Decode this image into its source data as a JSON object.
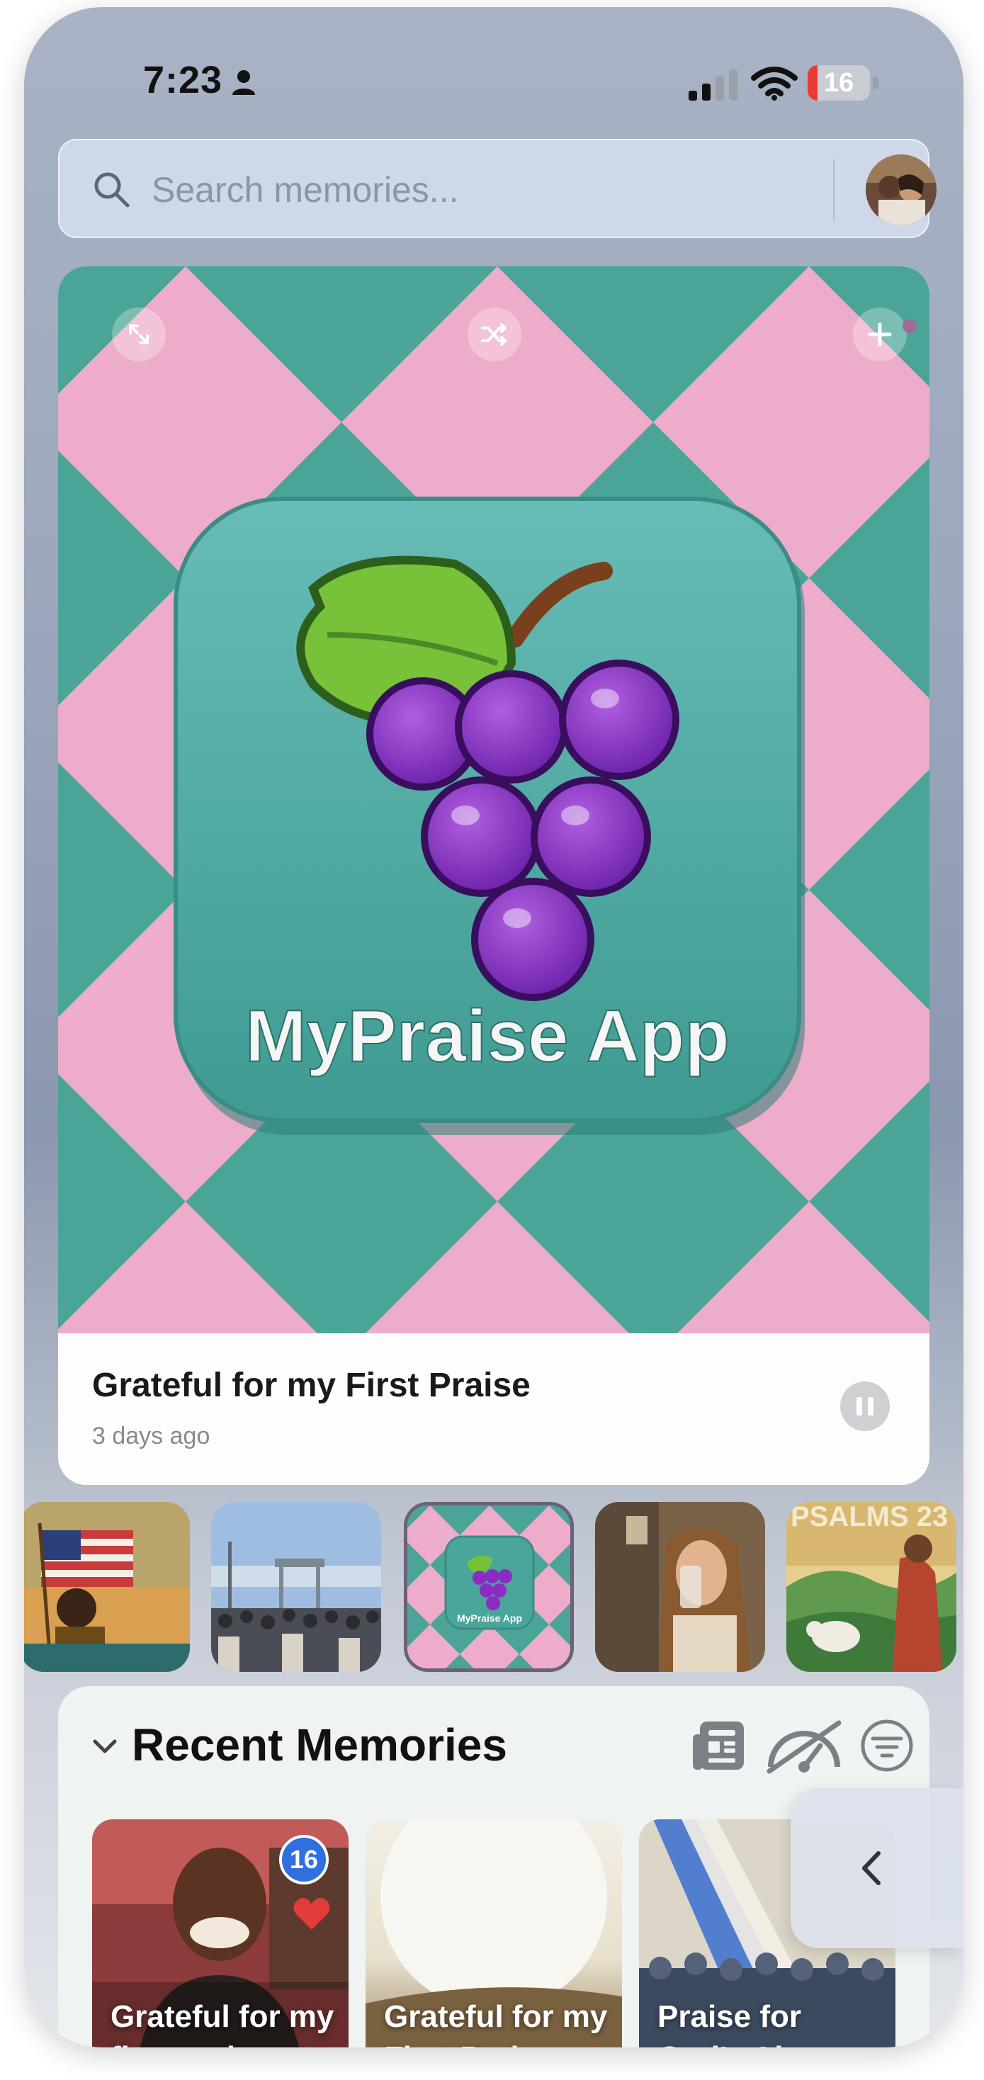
{
  "status_bar": {
    "time": "7:23",
    "battery_level": "16",
    "battery_fraction": 0.16
  },
  "search": {
    "placeholder": "Search memories..."
  },
  "hero": {
    "app_name": "MyPraise App",
    "title": "Grateful for my First Praise",
    "subtitle": "3 days ago",
    "controls": [
      "expand-icon",
      "shuffle-icon",
      "plus-icon",
      "pause-icon"
    ]
  },
  "thumbnails": [
    {
      "label": "Flag celebration"
    },
    {
      "label": "Boardwalk crowd"
    },
    {
      "label": "MyPraise App",
      "selected": true
    },
    {
      "label": "Woman drinking"
    },
    {
      "label": "PSALMS 23"
    }
  ],
  "recent": {
    "title": "Recent Memories",
    "tools": [
      "news-icon",
      "speed-off-icon",
      "filter-icon"
    ],
    "cards": [
      {
        "title": "Grateful for my first prai...",
        "badge": "16"
      },
      {
        "title": "Grateful for my First Prai..."
      },
      {
        "title": "Praise for God's Abun..."
      }
    ]
  },
  "colors": {
    "pink": "#eeaccb",
    "teal": "#4aa598",
    "accent_badge": "#2f6fe0",
    "battery_low": "#ec3b36"
  }
}
